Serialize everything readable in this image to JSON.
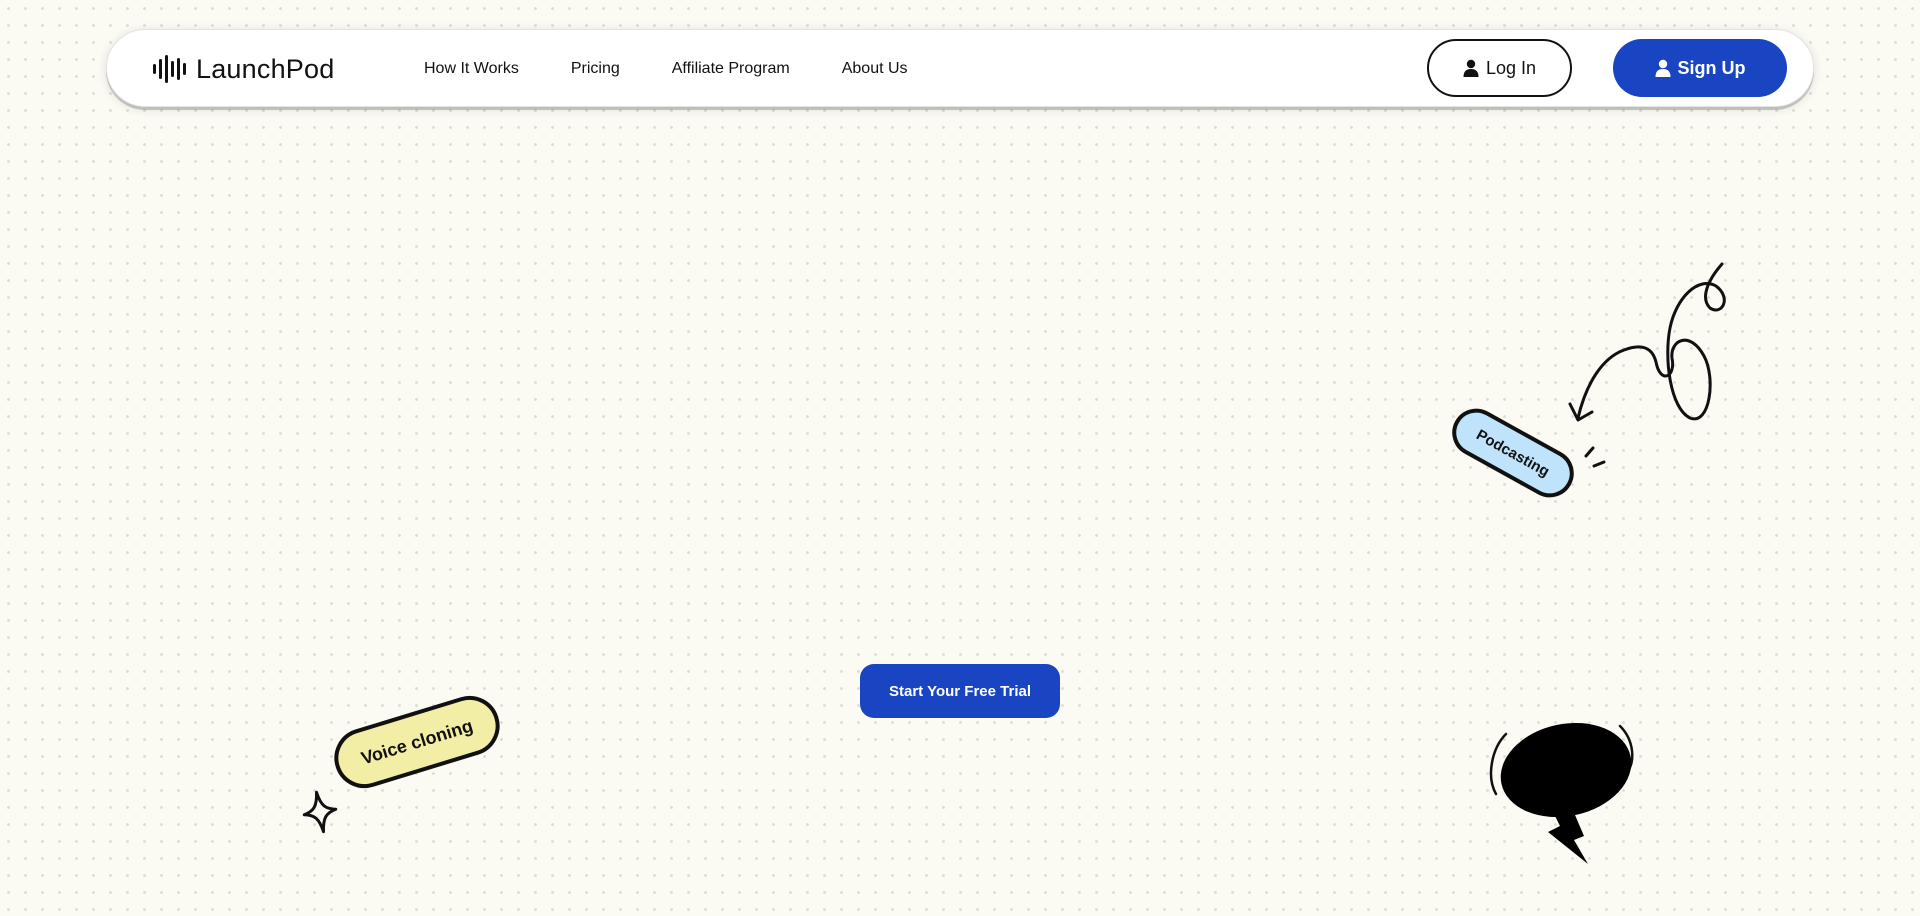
{
  "brand": {
    "name": "LaunchPod",
    "logo_icon": "sound-wave-icon"
  },
  "nav": {
    "links": [
      {
        "label": "How It Works"
      },
      {
        "label": "Pricing"
      },
      {
        "label": "Affiliate Program"
      },
      {
        "label": "About Us"
      }
    ],
    "login_label": "Log In",
    "signup_label": "Sign Up",
    "user_icon": "user-icon"
  },
  "hero": {
    "cta_label": "Start Your Free Trial"
  },
  "stickers": {
    "voice_cloning": "Voice cloning",
    "podcasting": "Podcasting"
  },
  "colors": {
    "background": "#fbfaf3",
    "primary": "#1a45c2",
    "sticker_yellow": "#f3eea6",
    "sticker_blue": "#bfe3fb"
  },
  "decorations": [
    "swirl-arrow-icon",
    "speech-bubble-icon",
    "sparkle-icon"
  ]
}
